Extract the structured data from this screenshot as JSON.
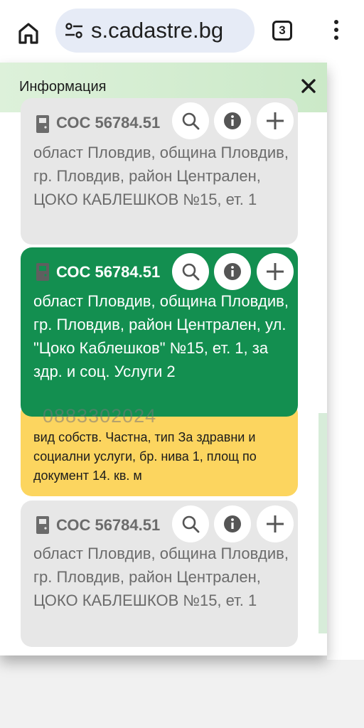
{
  "browser": {
    "url_fragment": "s.cadastre.bg",
    "tab_count": "3",
    "icons": [
      "home-icon",
      "tune-icon",
      "more-vert-icon"
    ]
  },
  "panel": {
    "title": "Информация",
    "close_icon": "close-icon"
  },
  "cards": [
    {
      "title": "СОС 56784.51",
      "title_tail": "5",
      "address": "област Пловдив, община Пловдив, гр. Пловдив, район Централен, ЦОКО КАБЛЕШКОВ №15, ет. 1",
      "selected": false
    },
    {
      "title": "СОС 56784.51",
      "title_tail": "5",
      "address": "област Пловдив, община Пловдив, гр. Пловдив, район Централен, ул. \"Цоко Каблешков\" №15, ет. 1, за здр. и соц. Услуги 2",
      "selected": true,
      "details": "вид собств. Частна, тип За здравни и социални услуги, бр. нива 1, площ по документ 14. кв. м"
    },
    {
      "title": "СОС 56784.51",
      "title_tail": "5",
      "address": "област Пловдив, община Пловдив, гр. Пловдив, район Централен, ЦОКО КАБЛЕШКОВ №15, ет. 1",
      "selected": false
    }
  ],
  "watermark": "0883302024",
  "colors": {
    "selected_card": "#138f50",
    "details_card": "#fcd55f",
    "card_gray": "#e7e7e7",
    "header_green": "#d5eed2"
  }
}
